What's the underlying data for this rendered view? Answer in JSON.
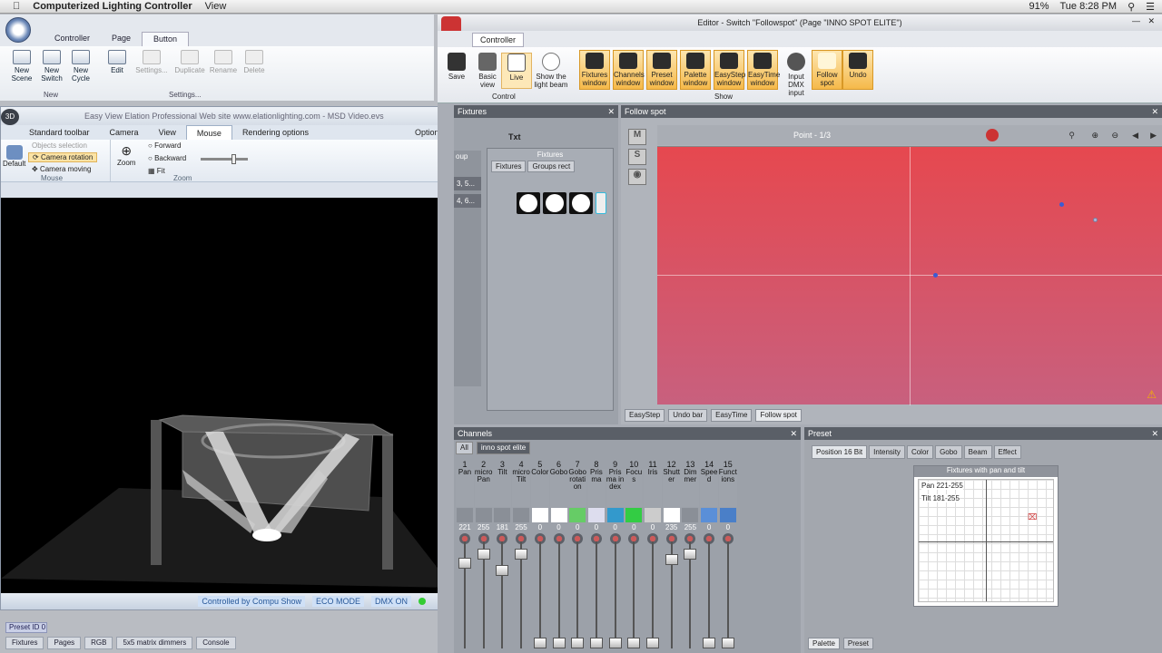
{
  "menubar": {
    "app_name": "Computerized Lighting Controller",
    "menu_view": "View",
    "battery": "91%",
    "clock": "Tue 8:28 PM"
  },
  "left_ribbon": {
    "tabs": [
      "Controller",
      "Page",
      "Button"
    ],
    "active_tab": "Button",
    "new_group": {
      "label": "New",
      "buttons": [
        "New\nScene",
        "New\nSwitch",
        "New\nCycle"
      ]
    },
    "settings_group": {
      "label": "Settings...",
      "buttons": [
        "Edit",
        "Settings...",
        "Duplicate",
        "Rename",
        "Delete"
      ]
    }
  },
  "view3d": {
    "title": "Easy View    Elation Professional    Web site www.elationlighting.com - MSD Video.evs",
    "tabs": [
      "Standard toolbar",
      "Camera",
      "View",
      "Mouse",
      "Rendering options"
    ],
    "active_tab": "Mouse",
    "options_label": "Options",
    "mouse_group": {
      "label": "Mouse",
      "default_label": "Default",
      "items": [
        "Objects selection",
        "Camera rotation",
        "Camera moving"
      ]
    },
    "zoom_group": {
      "label": "Zoom",
      "zoom_label": "Zoom",
      "items": [
        "Forward",
        "Backward",
        "Fit"
      ]
    },
    "status": [
      "Controlled by Compu Show",
      "ECO MODE",
      "DMX ON"
    ]
  },
  "bottom": {
    "preset_id": "Preset ID 0",
    "tabs": [
      "Fixtures",
      "Pages",
      "RGB",
      "5x5 matrix dimmers",
      "Console"
    ]
  },
  "editor": {
    "title": "Editor - Switch \"Followspot\" (Page \"INNO SPOT ELITE\")",
    "tab": "Controller",
    "control_group": "Control",
    "show_group": "Show",
    "control_buttons": [
      "Save",
      "Basic\nview",
      "Live",
      "Show the\nlight beam"
    ],
    "show_buttons": [
      "Fixtures\nwindow",
      "Channels\nwindow",
      "Preset\nwindow",
      "Palette\nwindow",
      "EasyStep\nwindow",
      "EasyTime\nwindow",
      "Input\nDMX\ninput",
      "Follow\nspot",
      "Undo"
    ],
    "fixtures_panel": {
      "title": "Fixtures",
      "left_col": "oup",
      "left_items": [
        "3, 5...",
        "4, 6..."
      ],
      "sub_title": "Fixtures",
      "sub_tabs": [
        "Fixtures",
        "Groups rect"
      ],
      "txt_label": "Txt"
    },
    "follow_panel": {
      "title": "Follow spot",
      "point_label": "Point - 1/3",
      "mode_buttons": [
        "M",
        "S"
      ],
      "footer_tabs": [
        "EasyStep",
        "Undo bar",
        "EasyTime",
        "Follow spot"
      ],
      "gradient_top": "#e6484f",
      "gradient_bottom": "#c8607e"
    },
    "channels_panel": {
      "title": "Channels",
      "sub_tabs": [
        "All",
        "inno spot elite"
      ],
      "channels": [
        {
          "n": "1",
          "name": "Pan",
          "val": "221"
        },
        {
          "n": "2",
          "name": "micro Pan",
          "val": "255"
        },
        {
          "n": "3",
          "name": "Tilt",
          "val": "181"
        },
        {
          "n": "4",
          "name": "micro Tilt",
          "val": "255"
        },
        {
          "n": "5",
          "name": "Color",
          "val": "0"
        },
        {
          "n": "6",
          "name": "Gobo",
          "val": "0"
        },
        {
          "n": "7",
          "name": "Gobo rotation",
          "val": "0"
        },
        {
          "n": "8",
          "name": "Prisma",
          "val": "0"
        },
        {
          "n": "9",
          "name": "Prisma index",
          "val": "0"
        },
        {
          "n": "10",
          "name": "Focus",
          "val": "0"
        },
        {
          "n": "11",
          "name": "Iris",
          "val": "0"
        },
        {
          "n": "12",
          "name": "Shutter",
          "val": "235"
        },
        {
          "n": "13",
          "name": "Dimmer",
          "val": "255"
        },
        {
          "n": "14",
          "name": "Speed",
          "val": "0"
        },
        {
          "n": "15",
          "name": "Functions",
          "val": "0"
        }
      ]
    },
    "preset_panel": {
      "title": "Preset",
      "tabs": [
        "Position 16 Bit",
        "Intensity",
        "Color",
        "Gobo",
        "Beam",
        "Effect"
      ],
      "active_tab": "Position 16 Bit",
      "box_title": "Fixtures with pan and tilt",
      "pan_label": "Pan 221-255",
      "tilt_label": "Tilt 181-255",
      "footer_tabs": [
        "Palette",
        "Preset"
      ]
    }
  }
}
